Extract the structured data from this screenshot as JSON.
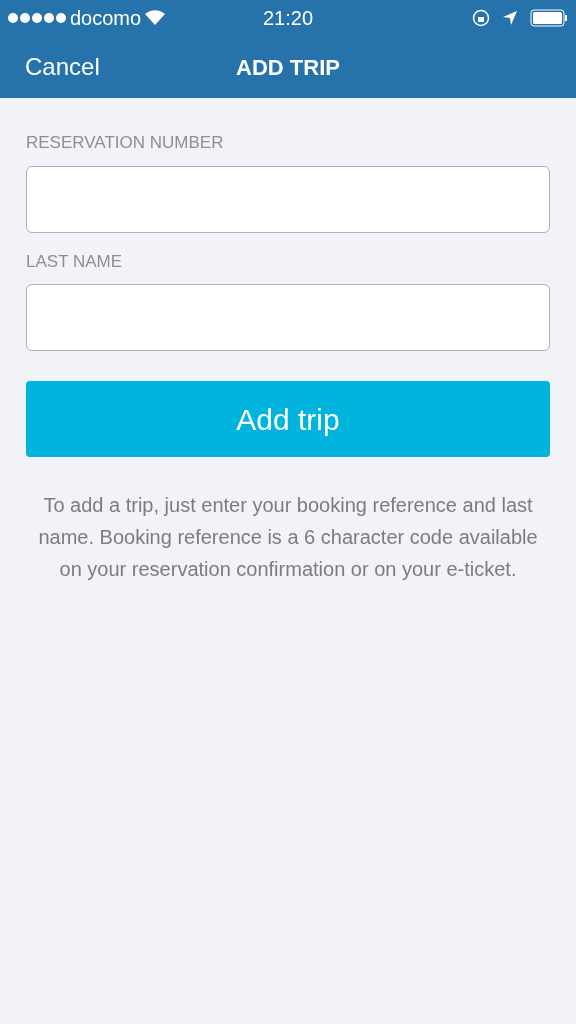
{
  "status_bar": {
    "carrier": "docomo",
    "time": "21:20"
  },
  "nav": {
    "cancel": "Cancel",
    "title": "ADD TRIP"
  },
  "fields": [
    {
      "label": "RESERVATION NUMBER"
    },
    {
      "label": "LAST NAME"
    }
  ],
  "submit": "Add trip",
  "help_text": "To add a trip, just enter your booking reference and last name. Booking reference is a 6 character code available on your reservation confirmation or on your e-ticket."
}
